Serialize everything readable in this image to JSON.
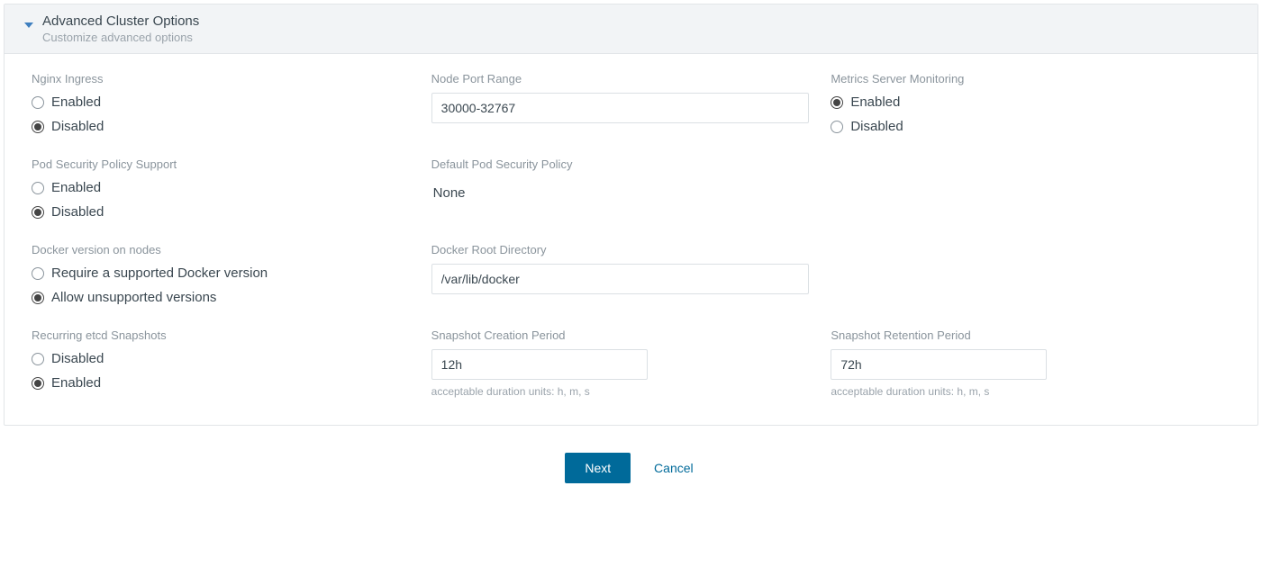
{
  "header": {
    "title": "Advanced Cluster Options",
    "subtitle": "Customize advanced options"
  },
  "fields": {
    "nginx_ingress": {
      "label": "Nginx Ingress",
      "enabled": "Enabled",
      "disabled": "Disabled"
    },
    "node_port_range": {
      "label": "Node Port Range",
      "value": "30000-32767"
    },
    "metrics_server": {
      "label": "Metrics Server Monitoring",
      "enabled": "Enabled",
      "disabled": "Disabled"
    },
    "pod_security": {
      "label": "Pod Security Policy Support",
      "enabled": "Enabled",
      "disabled": "Disabled"
    },
    "default_psp": {
      "label": "Default Pod Security Policy",
      "value": "None"
    },
    "docker_version": {
      "label": "Docker version on nodes",
      "require": "Require a supported Docker version",
      "allow": "Allow unsupported versions"
    },
    "docker_root": {
      "label": "Docker Root Directory",
      "value": "/var/lib/docker"
    },
    "etcd_snapshots": {
      "label": "Recurring etcd Snapshots",
      "disabled": "Disabled",
      "enabled": "Enabled"
    },
    "snapshot_creation": {
      "label": "Snapshot Creation Period",
      "value": "12h",
      "hint": "acceptable duration units: h, m, s"
    },
    "snapshot_retention": {
      "label": "Snapshot Retention Period",
      "value": "72h",
      "hint": "acceptable duration units: h, m, s"
    }
  },
  "footer": {
    "next": "Next",
    "cancel": "Cancel"
  }
}
